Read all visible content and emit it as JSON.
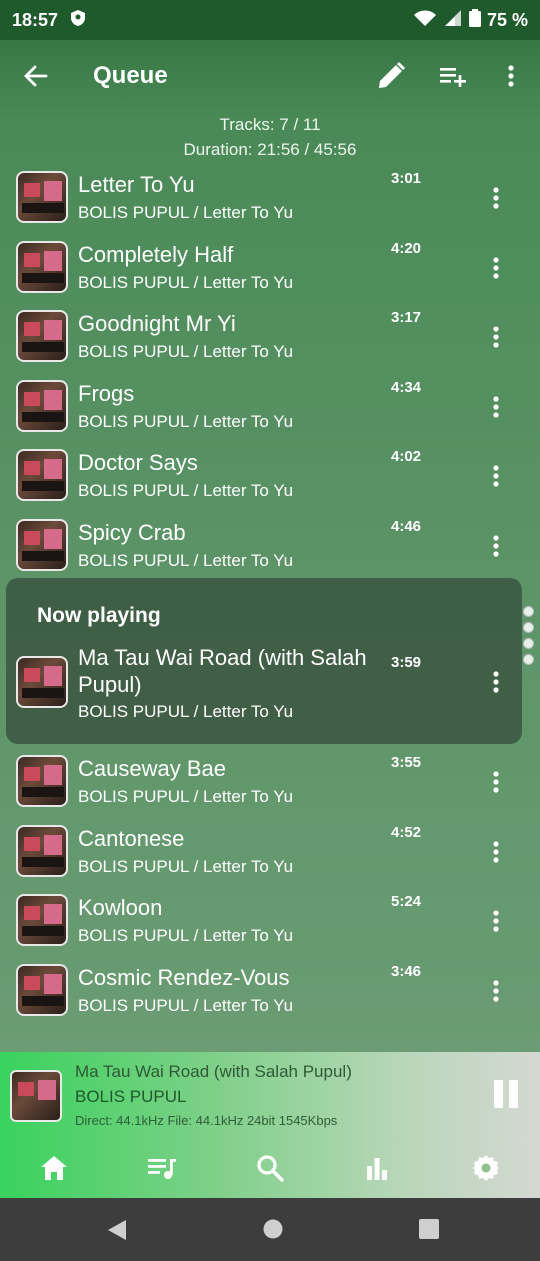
{
  "status": {
    "time": "18:57",
    "battery": "75 %"
  },
  "appbar": {
    "title": "Queue"
  },
  "stats": {
    "tracks": "Tracks: 7 / 11",
    "duration": "Duration: 21:56 / 45:56"
  },
  "tracks": [
    {
      "title": "Letter To Yu",
      "sub": "BOLIS PUPUL / Letter To Yu",
      "dur": "3:01"
    },
    {
      "title": "Completely Half",
      "sub": "BOLIS PUPUL / Letter To Yu",
      "dur": "4:20"
    },
    {
      "title": "Goodnight Mr Yi",
      "sub": "BOLIS PUPUL / Letter To Yu",
      "dur": "3:17"
    },
    {
      "title": "Frogs",
      "sub": "BOLIS PUPUL / Letter To Yu",
      "dur": "4:34"
    },
    {
      "title": "Doctor Says",
      "sub": "BOLIS PUPUL / Letter To Yu",
      "dur": "4:02"
    },
    {
      "title": "Spicy Crab",
      "sub": "BOLIS PUPUL / Letter To Yu",
      "dur": "4:46"
    }
  ],
  "now_playing": {
    "label": "Now playing",
    "title": "Ma Tau Wai Road (with Salah Pupul)",
    "sub": "BOLIS PUPUL / Letter To Yu",
    "dur": "3:59"
  },
  "tracks_after": [
    {
      "title": "Causeway Bae",
      "sub": "BOLIS PUPUL / Letter To Yu",
      "dur": "3:55"
    },
    {
      "title": "Cantonese",
      "sub": "BOLIS PUPUL / Letter To Yu",
      "dur": "4:52"
    },
    {
      "title": "Kowloon",
      "sub": "BOLIS PUPUL / Letter To Yu",
      "dur": "5:24"
    },
    {
      "title": "Cosmic Rendez-Vous",
      "sub": "BOLIS PUPUL / Letter To Yu",
      "dur": "3:46"
    }
  ],
  "mini_player": {
    "title": "Ma Tau Wai Road (with Salah Pupul)",
    "artist": "BOLIS PUPUL",
    "info": "Direct: 44.1kHz  File: 44.1kHz  24bit  1545Kbps"
  },
  "tabs": [
    "home-icon",
    "queue-music-icon",
    "search-icon",
    "equalizer-icon",
    "settings-icon"
  ]
}
